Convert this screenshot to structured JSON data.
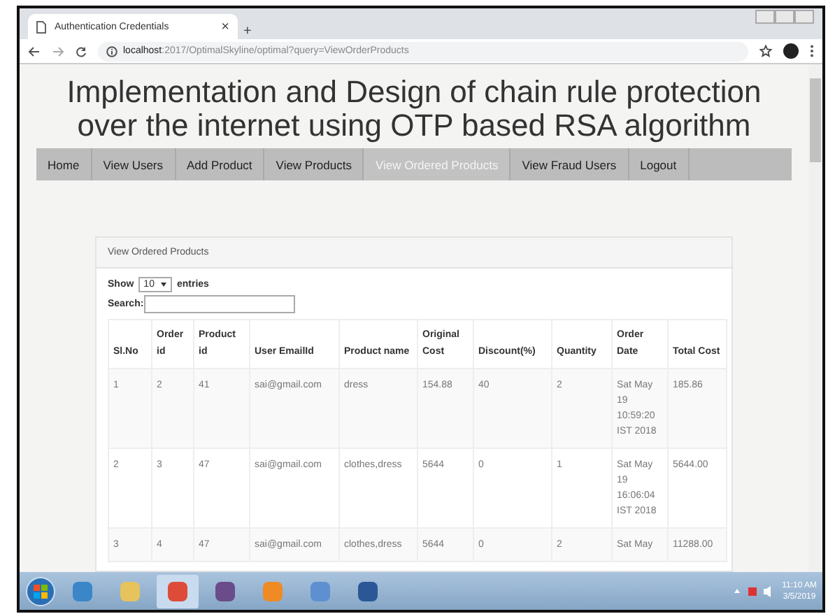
{
  "browser": {
    "tab_title": "Authentication Credentials",
    "tab_close": "×",
    "new_tab": "+",
    "url_host": "localhost",
    "url_rest": ":2017/OptimalSkyline/optimal?query=ViewOrderProducts"
  },
  "page": {
    "title": "Implementation and Design of chain rule protection over the internet using OTP based RSA algorithm",
    "nav": [
      {
        "label": "Home",
        "selected": false
      },
      {
        "label": "View Users",
        "selected": false
      },
      {
        "label": "Add Product",
        "selected": false
      },
      {
        "label": "View Products",
        "selected": false
      },
      {
        "label": "View Ordered Products",
        "selected": true
      },
      {
        "label": "View Fraud Users",
        "selected": false
      },
      {
        "label": "Logout",
        "selected": false
      }
    ],
    "panel": {
      "heading": "View Ordered Products",
      "show_label": "Show",
      "page_size": "10",
      "entries_label": "entries",
      "search_label": "Search:",
      "table": {
        "columns": [
          "Sl.No",
          "Order id",
          "Product id",
          "User EmailId",
          "Product name",
          "Original Cost",
          "Discount(%)",
          "Quantity",
          "Order Date",
          "Total Cost"
        ],
        "rows": [
          [
            "1",
            "2",
            "41",
            "sai@gmail.com",
            "dress",
            "154.88",
            "40",
            "2",
            "Sat May 19 10:59:20 IST 2018",
            "185.86"
          ],
          [
            "2",
            "3",
            "47",
            "sai@gmail.com",
            "clothes,dress",
            "5644",
            "0",
            "1",
            "Sat May 19 16:06:04 IST 2018",
            "5644.00"
          ],
          [
            "3",
            "4",
            "47",
            "sai@gmail.com",
            "clothes,dress",
            "5644",
            "0",
            "2",
            "Sat May",
            "11288.00"
          ]
        ]
      }
    }
  },
  "taskbar": {
    "time": "11:10 AM",
    "date": "3/5/2019"
  }
}
